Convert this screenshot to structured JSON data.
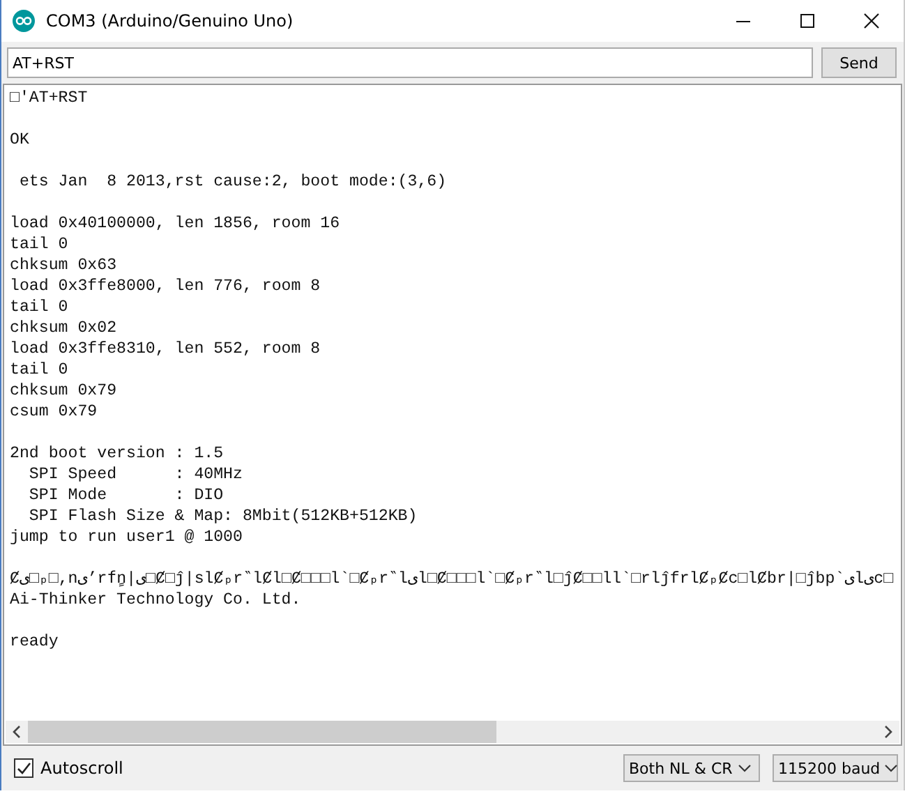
{
  "window": {
    "title": "COM3 (Arduino/Genuino Uno)"
  },
  "input": {
    "value": "AT+RST"
  },
  "send_button": {
    "label": "Send"
  },
  "output": {
    "blocks": [
      [
        "□ʹAT+RST"
      ],
      [
        "OK"
      ],
      [
        " ets Jan  8 2013,rst cause:2, boot mode:(3,6)"
      ],
      [
        "load 0x40100000, len 1856, room 16",
        "tail 0",
        "chksum 0x63",
        "load 0x3ffe8000, len 776, room 8",
        "tail 0",
        "chksum 0x02",
        "load 0x3ffe8310, len 552, room 8",
        "tail 0",
        "chksum 0x79",
        "csum 0x79"
      ],
      [
        "2nd boot version : 1.5",
        "  SPI Speed      : 40MHz",
        "  SPI Mode       : DIO",
        "  SPI Flash Size & Map: 8Mbit(512KB+512KB)",
        "jump to run user1 @ 1000"
      ],
      [
        "Ȼى□ₚ□,nى’rfٍn|ى□Ȼ□ĵ|slȻₚr‶lȻl□Ȼ□□□l`□Ȼₚr‶lىl□Ȼ□□□l`□Ȼₚr‶l□ĵȻ□□ll`□rlĵfrlȻₚȻc□lȻbr|□ĵbp`ىlىc□",
        "Ai-Thinker Technology Co. Ltd."
      ],
      [
        "ready"
      ]
    ]
  },
  "footer": {
    "autoscroll": {
      "label": "Autoscroll",
      "checked": true
    },
    "line_ending": "Both NL & CR",
    "baud_rate": "115200 baud"
  }
}
